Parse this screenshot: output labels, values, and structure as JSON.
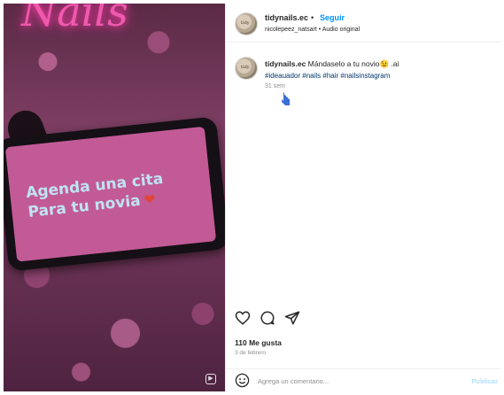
{
  "media": {
    "neon_text": "Nails",
    "phone_lines": [
      "Agenda una cita",
      "Para tu novia"
    ],
    "heart_icon": "heart-emoji",
    "reel_icon": "reel-icon"
  },
  "header": {
    "username": "tidynails.ec",
    "separator": "•",
    "follow_label": "Seguir",
    "audio_line": "nicolepeez_natsart • Audio original"
  },
  "caption": {
    "username": "tidynails.ec",
    "text": " Mándaselo a tu novio😉 .ai",
    "hashtags": "#ideauador #nails #hair #nailsinstagram",
    "time": "31 sem"
  },
  "actions": {
    "like_icon": "heart-outline-icon",
    "comment_icon": "comment-bubble-icon",
    "share_icon": "paper-plane-icon"
  },
  "likes": "110 Me gusta",
  "date": "3 de febrero",
  "comment_bar": {
    "placeholder": "Agrega un comentario...",
    "publish_label": "Publicar"
  },
  "colors": {
    "accent": "#0095f6",
    "hashtag": "#00376b",
    "neon": "#ff5fb8",
    "phone_screen": "#c25a96"
  }
}
